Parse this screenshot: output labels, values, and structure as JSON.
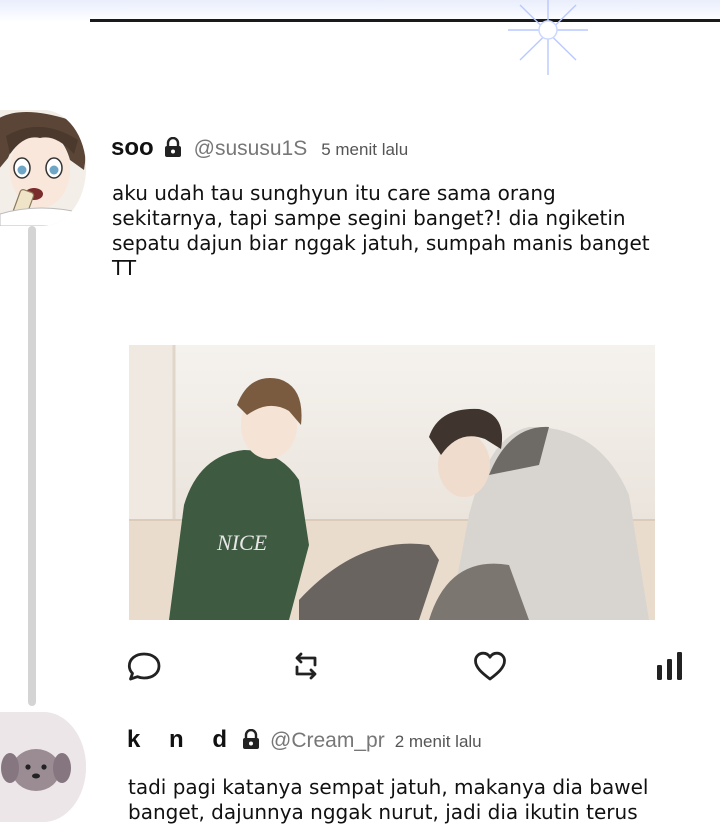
{
  "posts": [
    {
      "display_name": "soo",
      "handle": "@sususu1S",
      "time": "5 menit lalu",
      "text": "aku udah tau sunghyun itu care sama orang sekitarnya, tapi sampe segini banget?! dia ngiketin sepatu dajun biar nggak jatuh, sumpah manis banget TT",
      "locked": true,
      "avatar_icon": "avatar-anime-boy-recorder",
      "image_icon": "anime-illustration-two-boys-sitting",
      "image_text": "NICE"
    },
    {
      "display_name": "k n d",
      "handle": "@Cream_pr",
      "time": "2 menit lalu",
      "text": "tadi pagi katanya sempat jatuh, makanya dia bawel banget, dajunnya nggak nurut, jadi dia ikutin terus",
      "locked": true,
      "avatar_icon": "avatar-puppy"
    }
  ],
  "actions": [
    "reply-icon",
    "repost-icon",
    "like-icon",
    "stats-icon"
  ],
  "colors": {
    "text": "#111111",
    "handle": "#777777",
    "thread_line": "#d4d4d4",
    "icon": "#222222"
  }
}
